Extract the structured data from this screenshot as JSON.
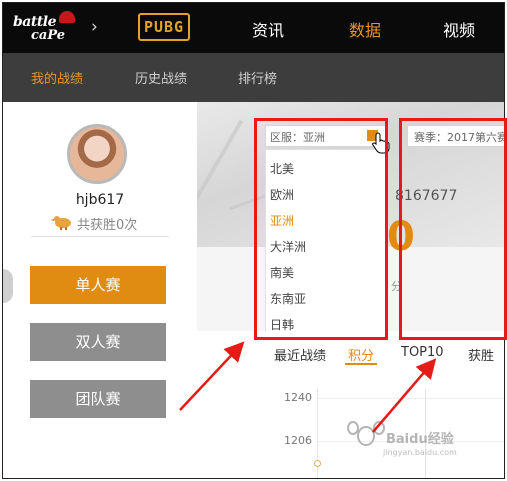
{
  "brand": {
    "logo_line1": "battle",
    "logo_line2": "caPe",
    "game_logo": "PUBG"
  },
  "topnav": {
    "items": [
      {
        "label": "资讯",
        "active": false
      },
      {
        "label": "数据",
        "active": true
      },
      {
        "label": "视频",
        "active": false
      }
    ]
  },
  "subnav": {
    "items": [
      {
        "label": "我的战绩",
        "active": true
      },
      {
        "label": "历史战绩",
        "active": false
      },
      {
        "label": "排行榜",
        "active": false
      }
    ]
  },
  "profile": {
    "username": "hjb617",
    "wins_text": "共获胜0次"
  },
  "modes": {
    "solo": "单人赛",
    "duo": "双人赛",
    "squad": "团队赛"
  },
  "region_select": {
    "value": "区服：亚洲",
    "options": [
      "北美",
      "欧洲",
      "亚洲",
      "大洋洲",
      "南美",
      "东南亚",
      "日韩"
    ],
    "selected_index": 2
  },
  "season_select": {
    "value": "赛季：2017第六赛"
  },
  "stats": {
    "partial_number": "8167677",
    "big_digit_fragment": "0",
    "unit_fragment": "分"
  },
  "tabs": {
    "recent": "最近战绩",
    "points": "积分",
    "top10": "TOP10",
    "wins": "获胜次"
  },
  "chart": {
    "yticks": [
      "1240",
      "1206"
    ]
  },
  "watermark": {
    "title": "Baidu经验",
    "url": "jingyan.baidu.com"
  },
  "colors": {
    "accent": "#e08c12",
    "annotation": "#e41b17",
    "topnav_bg": "#0a0a0a",
    "subnav_bg": "#3d3d3d"
  }
}
